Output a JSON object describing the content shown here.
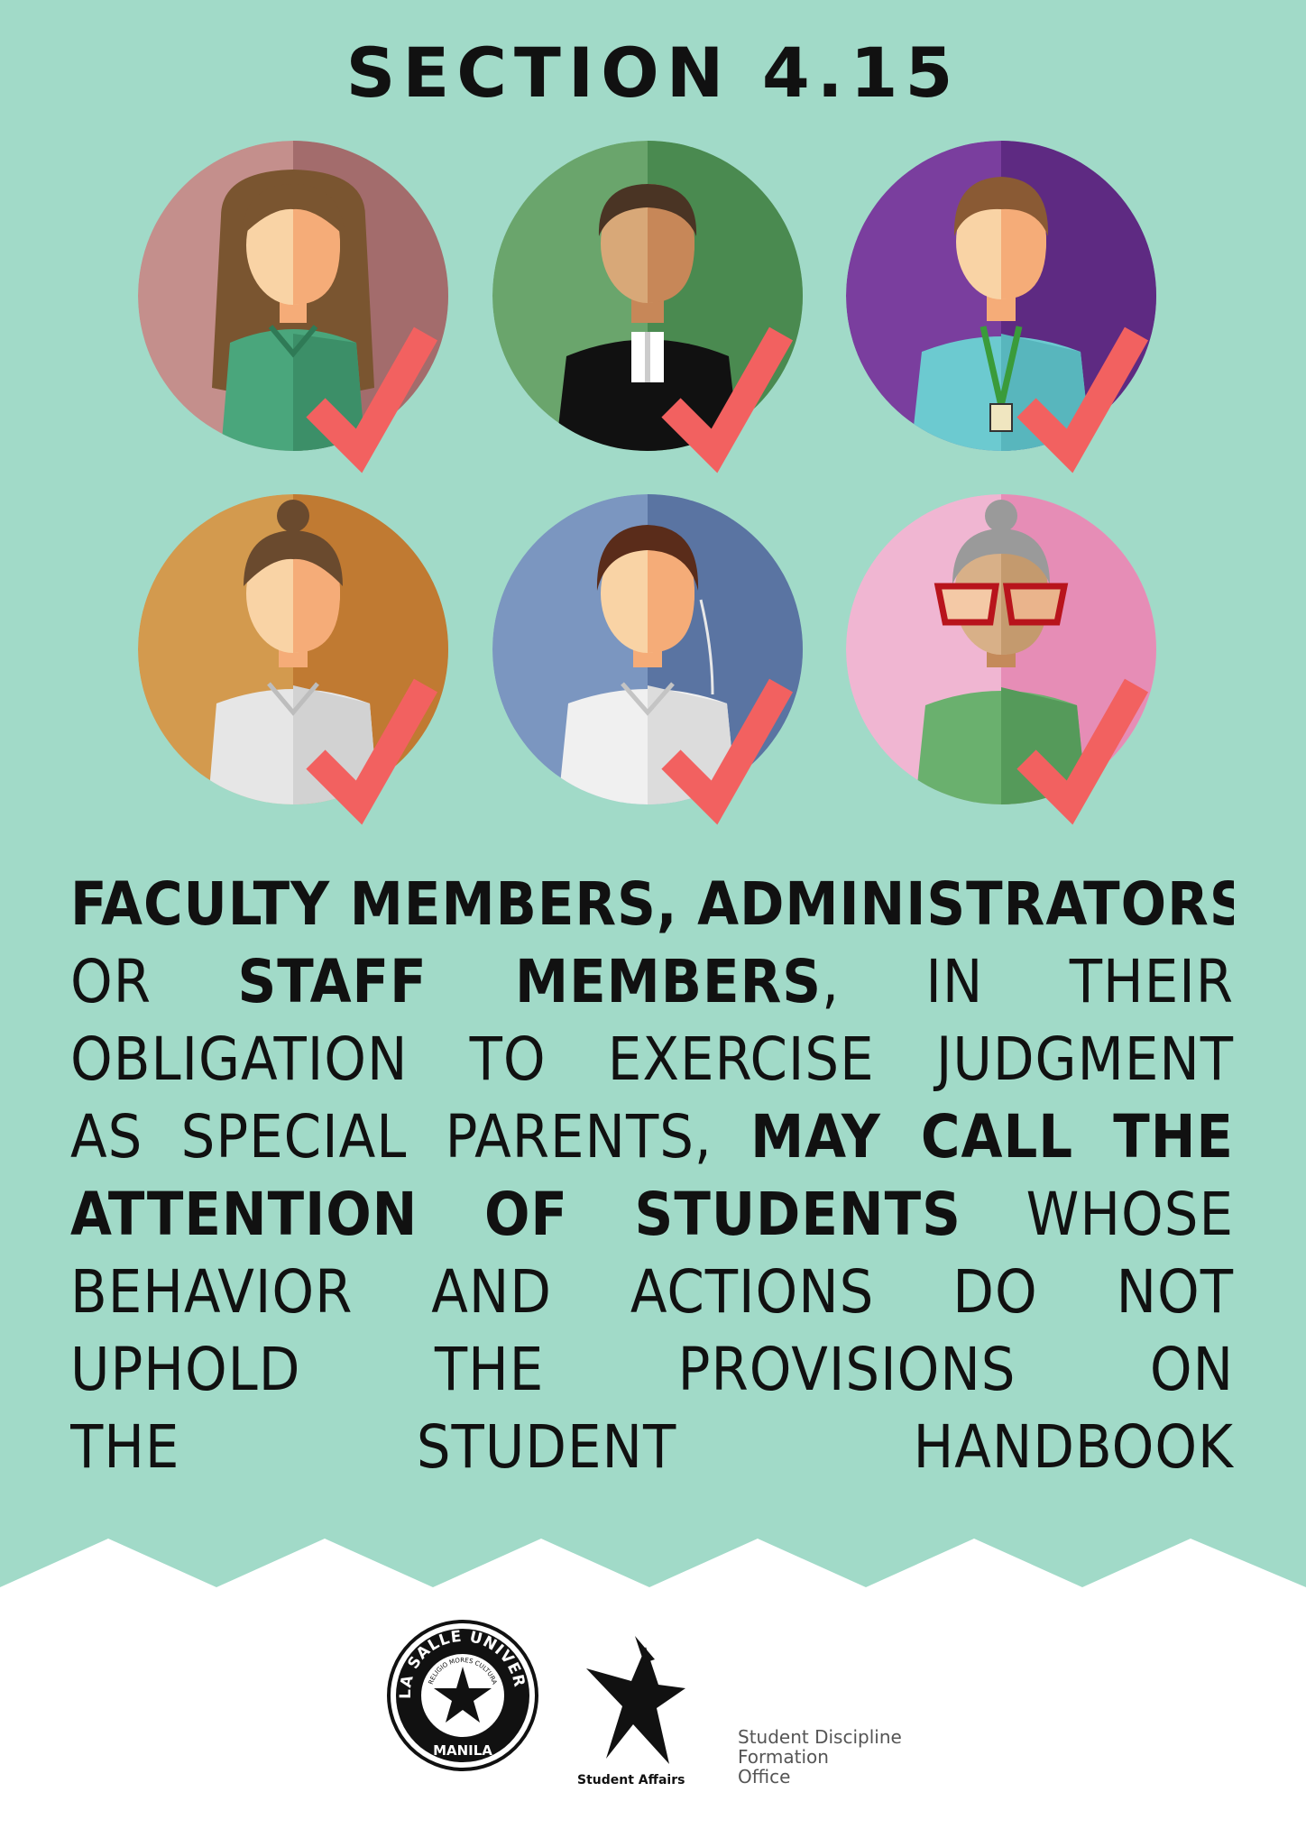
{
  "title": "SECTION 4.15",
  "body": {
    "line1": [
      {
        "t": "FACULTY MEMBERS, ADMINISTRATORS,",
        "b": true
      }
    ],
    "line2": [
      {
        "t": "OR ",
        "b": false
      },
      {
        "t": "STAFF MEMBERS",
        "b": true
      },
      {
        "t": ", IN THEIR",
        "b": false
      }
    ],
    "line3": [
      {
        "t": "OBLIGATION TO EXERCISE JUDGMENT",
        "b": false
      }
    ],
    "line4": [
      {
        "t": "AS SPECIAL PARENTS, ",
        "b": false
      },
      {
        "t": "MAY CALL THE",
        "b": true
      }
    ],
    "line5": [
      {
        "t": "ATTENTION OF STUDENTS",
        "b": true
      },
      {
        "t": " WHOSE",
        "b": false
      }
    ],
    "line6": [
      {
        "t": "BEHAVIOR AND ACTIONS DO NOT",
        "b": false
      }
    ],
    "line7": [
      {
        "t": "UPHOLD THE PROVISIONS ON",
        "b": false
      }
    ],
    "line8": [
      {
        "t": "THE STUDENT HANDBOOK",
        "b": false
      }
    ]
  },
  "avatars": [
    {
      "name": "female-faculty",
      "bg": "#c48f8c",
      "bg_dark": "#a36c6c",
      "hair": "#7a5530",
      "shirt": "#4aa67c"
    },
    {
      "name": "priest-administrator",
      "bg": "#6aa56c",
      "bg_dark": "#4a8a50",
      "hair": "#4a3424",
      "shirt": "#111111"
    },
    {
      "name": "staff-member-lanyard",
      "bg": "#7a3e9e",
      "bg_dark": "#5e2a82",
      "hair": "#8a5a34",
      "shirt": "#6ccad0"
    },
    {
      "name": "female-staff-bun",
      "bg": "#d39a4e",
      "bg_dark": "#c07a32",
      "hair": "#6a4a2e",
      "shirt": "#e6e6e6"
    },
    {
      "name": "security-guard",
      "bg": "#7b96c0",
      "bg_dark": "#5a74a2",
      "hair": "#5a2c1a",
      "shirt": "#f0f0f0"
    },
    {
      "name": "elderly-woman-glasses",
      "bg": "#f0b6d2",
      "bg_dark": "#e68db6",
      "hair": "#9a9a9a",
      "shirt": "#6ab06e"
    }
  ],
  "colors": {
    "background": "#a1dac8",
    "checkmark": "#f26160",
    "skin_light": "#f9d3a5",
    "skin_dark": "#f5ac78",
    "text": "#111111"
  },
  "footer": {
    "university_seal": {
      "top_text": "DE LA SALLE UNIVERSITY",
      "motto": "RELIGIO MORES CULTURA",
      "bottom_text": "MANILA"
    },
    "student_affairs_label": "Student Affairs",
    "office_lines": [
      "Student Discipline",
      "Formation",
      "Office"
    ]
  }
}
